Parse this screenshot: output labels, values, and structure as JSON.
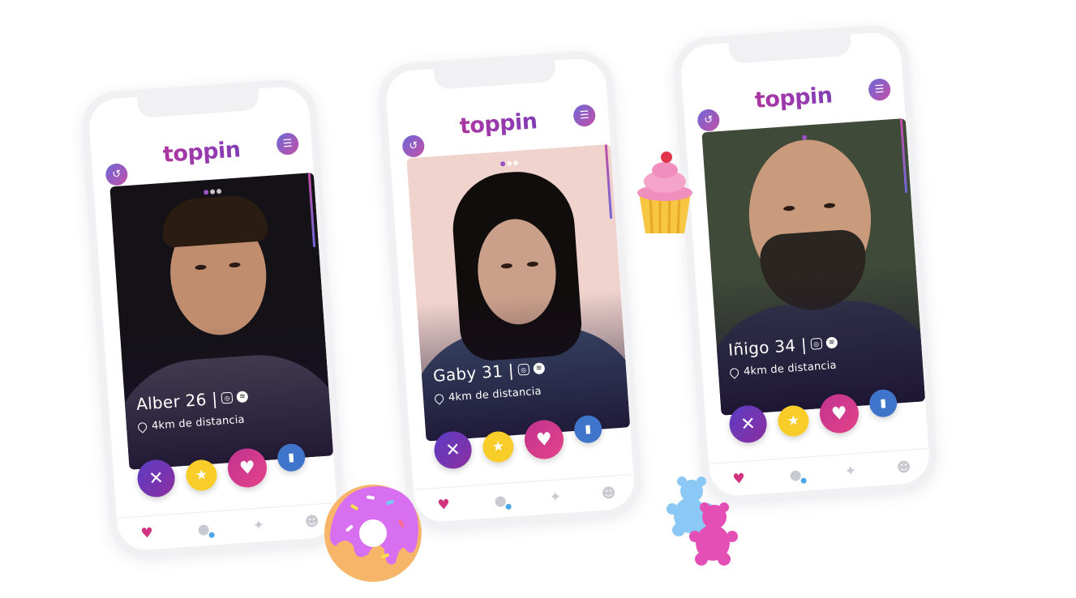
{
  "app": {
    "logo": "toppin",
    "accent_gradient": [
      "#d12f89",
      "#4c3aa8"
    ],
    "star_color": "#f9cd29",
    "boost_color": "#3e74c9"
  },
  "icons": {
    "undo": "↺",
    "filter": "☰",
    "dislike": "✕",
    "superlike": "★",
    "like": "♥",
    "boost": "▮",
    "tab_home": "♥",
    "tab_chat": "●",
    "tab_sparkle": "✦",
    "tab_profile": "☻",
    "instagram": "◎",
    "spotify": "≋"
  },
  "profiles": [
    {
      "name_age": "Alber 26 |",
      "distance": "4km de distancia",
      "active_dot": 0,
      "photo_bg": "#141217",
      "skin": "#c08e6f",
      "hair": "#2b1c12",
      "shirt": "#4a4457"
    },
    {
      "name_age": "Gaby 31 |",
      "distance": "4km de distancia",
      "active_dot": 0,
      "photo_bg": "#f0d3cd",
      "skin": "#caa08a",
      "hair": "#120d0d",
      "shirt": "#3c4c6c"
    },
    {
      "name_age": "Iñigo 34 |",
      "distance": "4km de distancia",
      "active_dot": 0,
      "photo_bg": "#3f4a38",
      "skin": "#c99a7c",
      "hair": "#2b2521",
      "shirt": "#33364e"
    }
  ]
}
